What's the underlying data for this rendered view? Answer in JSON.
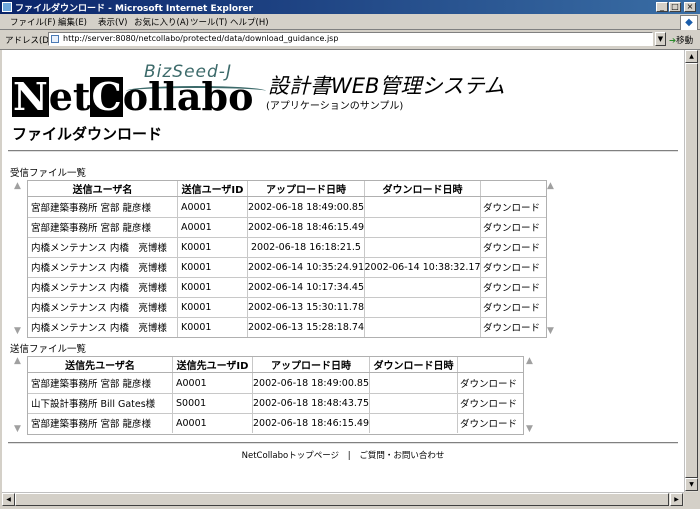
{
  "window": {
    "title": "ファイルダウンロード - Microsoft Internet Explorer",
    "min_label": "_",
    "max_label": "□",
    "close_label": "×"
  },
  "menu": [
    "ファイル(F)",
    "編集(E)",
    "表示(V)",
    "お気に入り(A)",
    "ツール(T)",
    "ヘルプ(H)"
  ],
  "address": {
    "label": "アドレス(D)",
    "url": "http://server:8080/netcollabo/protected/data/download_guidance.jsp",
    "go_label": "移動"
  },
  "header": {
    "logo": {
      "part1": "N",
      "part2": "et",
      "part3": "C",
      "part4": "ollabo"
    },
    "bizseed": "BizSeed-J",
    "system_title": "設計書WEB管理システム",
    "subtitle": "(アプリケーションのサンプル)",
    "page_title": "ファイルダウンロード"
  },
  "received": {
    "label": "受信ファイル一覧",
    "columns": [
      "送信ユーザ名",
      "送信ユーザID",
      "アップロード日時",
      "ダウンロード日時",
      ""
    ],
    "rows": [
      {
        "user": "宮部建築事務所 宮部 龍彦様",
        "id": "A0001",
        "uploaded": "2002-06-18 18:49:00.85",
        "downloaded": "",
        "action": "ダウンロード"
      },
      {
        "user": "宮部建築事務所 宮部 龍彦様",
        "id": "A0001",
        "uploaded": "2002-06-18 18:46:15.49",
        "downloaded": "",
        "action": "ダウンロード"
      },
      {
        "user": "内橋メンテナンス 内橋　亮博様",
        "id": "K0001",
        "uploaded": "2002-06-18 16:18:21.5",
        "downloaded": "",
        "action": "ダウンロード"
      },
      {
        "user": "内橋メンテナンス 内橋　亮博様",
        "id": "K0001",
        "uploaded": "2002-06-14 10:35:24.91",
        "downloaded": "2002-06-14 10:38:32.17",
        "action": "ダウンロード"
      },
      {
        "user": "内橋メンテナンス 内橋　亮博様",
        "id": "K0001",
        "uploaded": "2002-06-14 10:17:34.45",
        "downloaded": "",
        "action": "ダウンロード"
      },
      {
        "user": "内橋メンテナンス 内橋　亮博様",
        "id": "K0001",
        "uploaded": "2002-06-13 15:30:11.78",
        "downloaded": "",
        "action": "ダウンロード"
      },
      {
        "user": "内橋メンテナンス 内橋　亮博様",
        "id": "K0001",
        "uploaded": "2002-06-13 15:28:18.74",
        "downloaded": "",
        "action": "ダウンロード"
      }
    ]
  },
  "sent": {
    "label": "送信ファイル一覧",
    "columns": [
      "送信先ユーザ名",
      "送信先ユーザID",
      "アップロード日時",
      "ダウンロード日時",
      ""
    ],
    "rows": [
      {
        "user": "宮部建築事務所 宮部 龍彦様",
        "id": "A0001",
        "uploaded": "2002-06-18 18:49:00.85",
        "downloaded": "",
        "action": "ダウンロード"
      },
      {
        "user": "山下設計事務所 Bill Gates様",
        "id": "S0001",
        "uploaded": "2002-06-18 18:48:43.75",
        "downloaded": "",
        "action": "ダウンロード"
      },
      {
        "user": "宮部建築事務所 宮部 龍彦様",
        "id": "A0001",
        "uploaded": "2002-06-18 18:46:15.49",
        "downloaded": "",
        "action": "ダウンロード"
      }
    ]
  },
  "footer": {
    "top_link": "NetCollaboトップページ",
    "separator": "|",
    "contact_link": "ご質問・お問い合わせ"
  }
}
